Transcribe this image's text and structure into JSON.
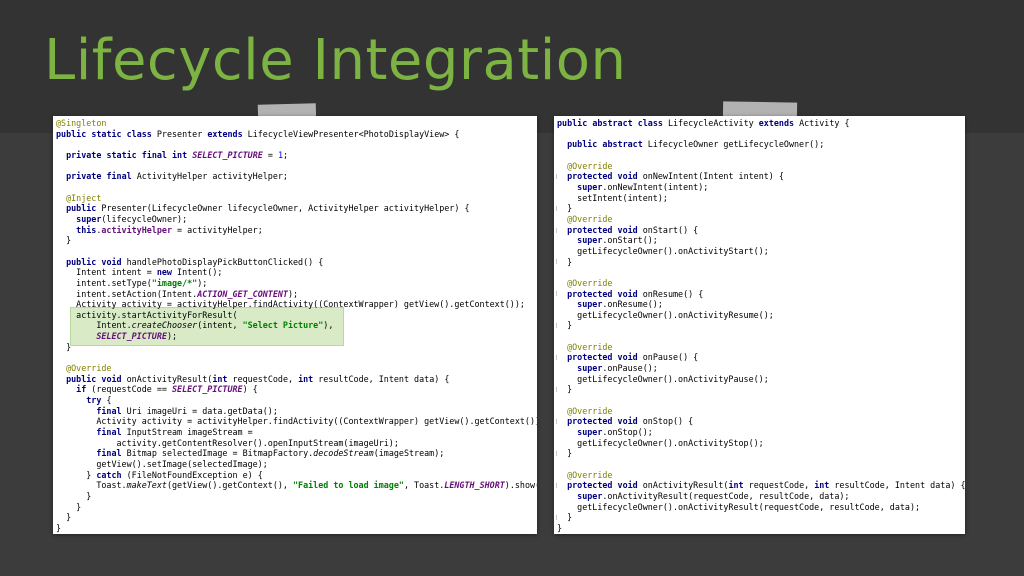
{
  "slide": {
    "title": "Lifecycle Integration"
  },
  "colors": {
    "title": "#7cb342",
    "background": "#3a3a3a",
    "keyword": "#000080",
    "annotation": "#808000",
    "string": "#008000",
    "field": "#660e7a",
    "highlight": "#d8ebc6"
  },
  "left_code": {
    "lines": [
      "@Singleton",
      "public static class Presenter extends LifecycleViewPresenter<PhotoDisplayView> {",
      "",
      "  private static final int SELECT_PICTURE = 1;",
      "",
      "  private final ActivityHelper activityHelper;",
      "",
      "  @Inject",
      "  public Presenter(LifecycleOwner lifecycleOwner, ActivityHelper activityHelper) {",
      "    super(lifecycleOwner);",
      "    this.activityHelper = activityHelper;",
      "  }",
      "",
      "  public void handlePhotoDisplayPickButtonClicked() {",
      "    Intent intent = new Intent();",
      "    intent.setType(\"image/*\");",
      "    intent.setAction(Intent.ACTION_GET_CONTENT);",
      "    Activity activity = activityHelper.findActivity((ContextWrapper) getView().getContext());",
      "    activity.startActivityForResult(",
      "        Intent.createChooser(intent, \"Select Picture\"),",
      "        SELECT_PICTURE);",
      "  }",
      "",
      "  @Override",
      "  public void onActivityResult(int requestCode, int resultCode, Intent data) {",
      "    if (requestCode == SELECT_PICTURE) {",
      "      try {",
      "        final Uri imageUri = data.getData();",
      "        Activity activity = activityHelper.findActivity((ContextWrapper) getView().getContext());",
      "        final InputStream imageStream =",
      "            activity.getContentResolver().openInputStream(imageUri);",
      "        final Bitmap selectedImage = BitmapFactory.decodeStream(imageStream);",
      "        getView().setImage(selectedImage);",
      "      } catch (FileNotFoundException e) {",
      "        Toast.makeText(getView().getContext(), \"Failed to load image\", Toast.LENGTH_SHORT).show();",
      "      }",
      "    }",
      "  }",
      "}"
    ]
  },
  "right_code": {
    "lines": [
      "public abstract class LifecycleActivity extends Activity {",
      "",
      "  public abstract LifecycleOwner getLifecycleOwner();",
      "",
      "  @Override",
      "  protected void onNewIntent(Intent intent) {",
      "    super.onNewIntent(intent);",
      "    setIntent(intent);",
      "  }",
      "  @Override",
      "  protected void onStart() {",
      "    super.onStart();",
      "    getLifecycleOwner().onActivityStart();",
      "  }",
      "",
      "  @Override",
      "  protected void onResume() {",
      "    super.onResume();",
      "    getLifecycleOwner().onActivityResume();",
      "  }",
      "",
      "  @Override",
      "  protected void onPause() {",
      "    super.onPause();",
      "    getLifecycleOwner().onActivityPause();",
      "  }",
      "",
      "  @Override",
      "  protected void onStop() {",
      "    super.onStop();",
      "    getLifecycleOwner().onActivityStop();",
      "  }",
      "",
      "  @Override",
      "  protected void onActivityResult(int requestCode, int resultCode, Intent data) {",
      "    super.onActivityResult(requestCode, resultCode, data);",
      "    getLifecycleOwner().onActivityResult(requestCode, resultCode, data);",
      "  }",
      "}"
    ]
  }
}
